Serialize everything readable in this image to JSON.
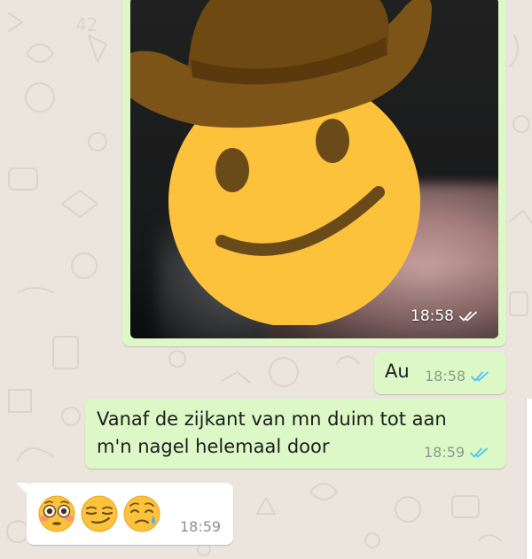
{
  "chat": {
    "messages": [
      {
        "type": "image",
        "direction": "outgoing",
        "time": "18:58",
        "status": "read",
        "overlay_emoji": "cowboy-hat-face"
      },
      {
        "type": "text",
        "direction": "outgoing",
        "text": "Au",
        "time": "18:58",
        "status": "read"
      },
      {
        "type": "text",
        "direction": "outgoing",
        "line1": "Vanaf de zijkant van mn duim tot aan",
        "line2": "m'n nagel helemaal door",
        "time": "18:59",
        "status": "read"
      },
      {
        "type": "emoji",
        "direction": "incoming",
        "emojis": [
          "flushed-face-icon",
          "smirking-face-icon",
          "sad-but-relieved-face-icon"
        ],
        "time": "18:59"
      }
    ]
  },
  "colors": {
    "chat_background": "#ece5dd",
    "outgoing_bubble": "#dcf8c6",
    "incoming_bubble": "#ffffff",
    "read_ticks": "#4fc3f7"
  }
}
